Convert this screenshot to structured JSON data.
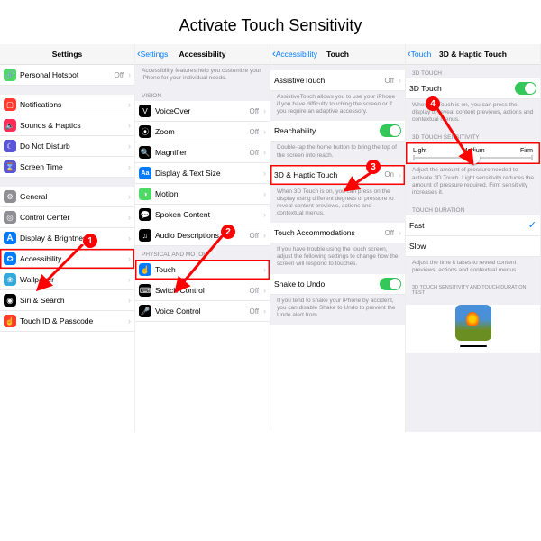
{
  "title": "Activate Touch Sensitivity",
  "pane1": {
    "hdr": "Settings",
    "r": [
      {
        "ic": "🔗",
        "bg": "#4cd964",
        "l": "Personal Hotspot",
        "v": "Off"
      },
      null,
      {
        "ic": "▢",
        "bg": "#ff3b30",
        "l": "Notifications"
      },
      {
        "ic": "🔈",
        "bg": "#ff2d55",
        "l": "Sounds & Haptics"
      },
      {
        "ic": "☾",
        "bg": "#5856d6",
        "l": "Do Not Disturb"
      },
      {
        "ic": "⌛",
        "bg": "#5856d6",
        "l": "Screen Time"
      },
      null,
      {
        "ic": "⚙",
        "bg": "#8e8e93",
        "l": "General"
      },
      {
        "ic": "◎",
        "bg": "#8e8e93",
        "l": "Control Center"
      },
      {
        "ic": "A",
        "bg": "#007aff",
        "l": "Display & Brightness"
      },
      {
        "ic": "✪",
        "bg": "#007aff",
        "l": "Accessibility",
        "hi": 1
      },
      {
        "ic": "❀",
        "bg": "#34aadc",
        "l": "Wallpaper"
      },
      {
        "ic": "◉",
        "bg": "#000",
        "l": "Siri & Search"
      },
      {
        "ic": "☝",
        "bg": "#ff3b30",
        "l": "Touch ID & Passcode"
      }
    ]
  },
  "pane2": {
    "back": "Settings",
    "hdr": "Accessibility",
    "desc": "Accessibility features help you customize your iPhone for your individual needs.",
    "sec1": "VISION",
    "r1": [
      {
        "ic": "V",
        "bg": "#000",
        "l": "VoiceOver",
        "v": "Off"
      },
      {
        "ic": "⦿",
        "bg": "#000",
        "l": "Zoom",
        "v": "Off"
      },
      {
        "ic": "🔍",
        "bg": "#000",
        "l": "Magnifier",
        "v": "Off"
      },
      {
        "ic": "Aa",
        "bg": "#007aff",
        "l": "Display & Text Size"
      },
      {
        "ic": "◑",
        "bg": "#4cd964",
        "l": "Motion"
      },
      {
        "ic": "💬",
        "bg": "#000",
        "l": "Spoken Content"
      },
      {
        "ic": "♫",
        "bg": "#000",
        "l": "Audio Descriptions",
        "v": "Off"
      }
    ],
    "sec2": "PHYSICAL AND MOTOR",
    "r2": [
      {
        "ic": "☝",
        "bg": "#007aff",
        "l": "Touch",
        "hi": 1
      },
      {
        "ic": "⌨",
        "bg": "#000",
        "l": "Switch Control",
        "v": "Off"
      },
      {
        "ic": "🎤",
        "bg": "#000",
        "l": "Voice Control",
        "v": "Off"
      }
    ]
  },
  "pane3": {
    "back": "Accessibility",
    "hdr": "Touch",
    "at": {
      "l": "AssistiveTouch",
      "v": "Off"
    },
    "atd": "AssistiveTouch allows you to use your iPhone if you have difficulty touching the screen or if you require an adaptive accessory.",
    "rc": {
      "l": "Reachability",
      "on": 1
    },
    "rcd": "Double-tap the home button to bring the top of the screen into reach.",
    "ht": {
      "l": "3D & Haptic Touch",
      "v": "On",
      "hi": 1
    },
    "htd": "When 3D Touch is on, you can press on the display using different degrees of pressure to reveal content previews, actions and contextual menus.",
    "ta": {
      "l": "Touch Accommodations",
      "v": "Off"
    },
    "tad": "If you have trouble using the touch screen, adjust the following settings to change how the screen will respond to touches.",
    "su": {
      "l": "Shake to Undo",
      "on": 1
    },
    "sud": "If you tend to shake your iPhone by accident, you can disable Shake to Undo to prevent the Undo alert from"
  },
  "pane4": {
    "back": "Touch",
    "hdr": "3D & Haptic Touch",
    "s1": "3D TOUCH",
    "t1": {
      "l": "3D Touch",
      "on": 1
    },
    "t1d": "When 3D Touch is on, you can press the display to reveal content previews, actions and contextual menus.",
    "s2": "3D TOUCH SENSITIVITY",
    "sl": {
      "l": "Light",
      "m": "Medium",
      "f": "Firm"
    },
    "sld": "Adjust the amount of pressure needed to activate 3D Touch. Light sensitivity reduces the amount of pressure required. Firm sensitivity increases it.",
    "s3": "TOUCH DURATION",
    "d1": {
      "l": "Fast",
      "chk": 1
    },
    "d2": {
      "l": "Slow"
    },
    "d3": "Adjust the time it takes to reveal content previews, actions and contextual menus.",
    "s4": "3D TOUCH SENSITIVITY AND TOUCH DURATION TEST"
  },
  "ann": {
    "1": "1",
    "2": "2",
    "3": "3",
    "4": "4"
  }
}
